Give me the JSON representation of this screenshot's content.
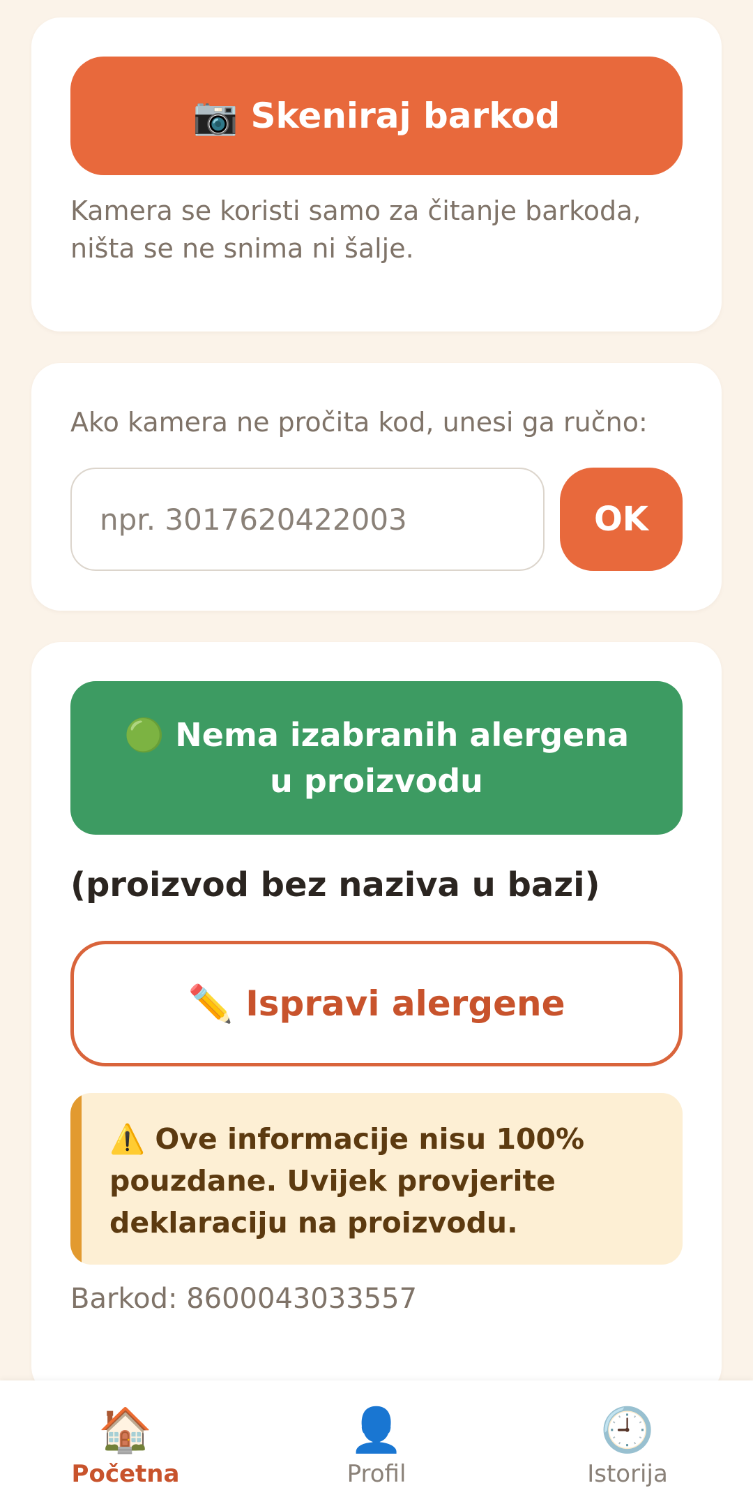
{
  "scan_card": {
    "button_icon": "📷",
    "button_label": "Skeniraj barkod",
    "hint": "Kamera se koristi samo za čitanje barkoda, ništa se ne snima ni šalje."
  },
  "manual_card": {
    "label": "Ako kamera ne pročita kod, unesi ga ručno:",
    "input_placeholder": "npr. 3017620422003",
    "input_value": "",
    "ok_label": "OK"
  },
  "result_card": {
    "status_icon": "🟢",
    "status_text": "Nema izabranih alergena u proizvodu",
    "product_name": "(proizvod bez naziva u bazi)",
    "edit_icon": "✏️",
    "edit_label": "Ispravi alergene",
    "warning_icon": "⚠️",
    "warning_text": "Ove informacije nisu 100% pouzdane. Uvijek provjerite deklaraciju na proizvodu.",
    "barcode_text": "Barkod: 8600043033557"
  },
  "bottom_nav": {
    "items": [
      {
        "icon": "🏠",
        "label": "Početna",
        "active": true
      },
      {
        "icon": "👤",
        "label": "Profil",
        "active": false
      },
      {
        "icon": "🕘",
        "label": "Istorija",
        "active": false
      }
    ]
  },
  "colors": {
    "accent": "#e8693c",
    "success": "#3d9b62",
    "warning_bg": "#fdefd4",
    "warning_stripe": "#e29a30",
    "background": "#fbf3e9"
  }
}
